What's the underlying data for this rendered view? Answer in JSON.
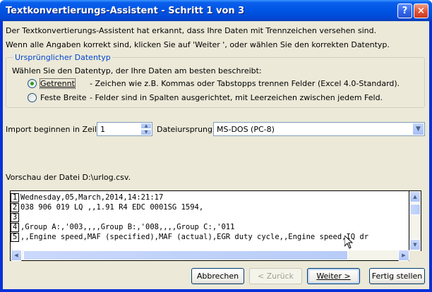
{
  "window": {
    "title": "Textkonvertierungs-Assistent - Schritt 1 von 3",
    "help_glyph": "?",
    "close_glyph": "×"
  },
  "intro": {
    "line1": "Der Textkonvertierungs-Assistent hat erkannt, dass Ihre Daten mit Trennzeichen versehen sind.",
    "line2": "Wenn alle Angaben korrekt sind, klicken Sie auf 'Weiter ', oder wählen Sie den korrekten Datentyp."
  },
  "datatype_group": {
    "legend": "Ursprünglicher Datentyp",
    "prompt": "Wählen Sie den Datentyp, der Ihre Daten am besten beschreibt:",
    "options": [
      {
        "label": "Getrennt",
        "description": "- Zeichen wie z.B. Kommas oder Tabstopps trennen Felder (Excel 4.0-Standard).",
        "checked": true
      },
      {
        "label": "Feste Breite",
        "description": "- Felder sind in Spalten ausgerichtet, mit Leerzeichen zwischen jedem Feld.",
        "checked": false
      }
    ]
  },
  "import_row": {
    "label": "Import beginnen in Zeile:",
    "value": "1",
    "origin_label": "Dateiursprung:",
    "origin_value": "MS-DOS (PC-8)"
  },
  "preview": {
    "label": "Vorschau der Datei D:\\urlog.csv.",
    "rows": [
      {
        "num": "1",
        "text": "Wednesday,05,March,2014,14:21:17"
      },
      {
        "num": "2",
        "text": "038 906 019 LQ ,,1.91 R4 EDC 0001SG  1594,"
      },
      {
        "num": "3",
        "text": ""
      },
      {
        "num": "4",
        "text": ",Group A:,'003,,,,Group B:,'008,,,,Group C:,'011"
      },
      {
        "num": "5",
        "text": ",,Engine speed,MAF (specified),MAF (actual),EGR duty cycle,,Engine speed,IQ dr"
      }
    ]
  },
  "buttons": {
    "cancel": "Abbrechen",
    "back": "< Zurück",
    "next": "Weiter >",
    "finish": "Fertig stellen"
  }
}
